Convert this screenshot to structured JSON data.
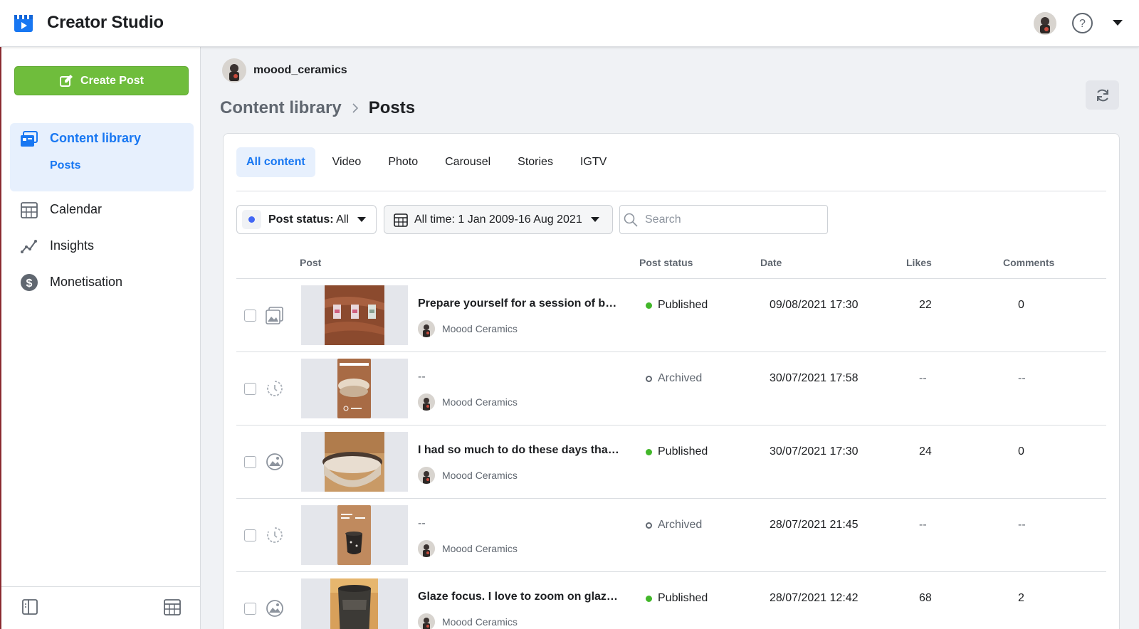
{
  "app": {
    "title": "Creator Studio"
  },
  "sidebar": {
    "create_label": "Create Post",
    "active_section": "Content library",
    "active_sub": "Posts",
    "items": [
      {
        "label": "Calendar",
        "icon": "calendar-icon"
      },
      {
        "label": "Insights",
        "icon": "insights-icon"
      },
      {
        "label": "Monetisation",
        "icon": "dollar-icon"
      }
    ]
  },
  "account": {
    "name": "moood_ceramics"
  },
  "breadcrumb": {
    "parent": "Content library",
    "current": "Posts"
  },
  "tabs": [
    "All content",
    "Video",
    "Photo",
    "Carousel",
    "Stories",
    "IGTV"
  ],
  "filters": {
    "status_prefix": "Post status:",
    "status_value": " All",
    "date_range": "All time: 1 Jan 2009-16 Aug 2021",
    "search_placeholder": "Search"
  },
  "table": {
    "headers": {
      "post": "Post",
      "status": "Post status",
      "date": "Date",
      "likes": "Likes",
      "comments": "Comments"
    },
    "rows": [
      {
        "title": "Prepare yourself for a session of befo…",
        "author": "Moood Ceramics",
        "status": "Published",
        "date": "09/08/2021 17:30",
        "likes": "22",
        "comments": "0",
        "type_icon": "carousel-icon"
      },
      {
        "title": "--",
        "author": "Moood Ceramics",
        "status": "Archived",
        "date": "30/07/2021 17:58",
        "likes": "--",
        "comments": "--",
        "type_icon": "story-icon"
      },
      {
        "title": "I had so much to do these days that I …",
        "author": "Moood Ceramics",
        "status": "Published",
        "date": "30/07/2021 17:30",
        "likes": "24",
        "comments": "0",
        "type_icon": "photo-icon"
      },
      {
        "title": "--",
        "author": "Moood Ceramics",
        "status": "Archived",
        "date": "28/07/2021 21:45",
        "likes": "--",
        "comments": "--",
        "type_icon": "story-icon"
      },
      {
        "title": "Glaze focus. I love to zoom on glaze t…",
        "author": "Moood Ceramics",
        "status": "Published",
        "date": "28/07/2021 12:42",
        "likes": "68",
        "comments": "2",
        "type_icon": "photo-icon"
      }
    ]
  },
  "colors": {
    "accent": "#1877f2",
    "create_button": "#6fbd3c",
    "published": "#42b72a"
  }
}
